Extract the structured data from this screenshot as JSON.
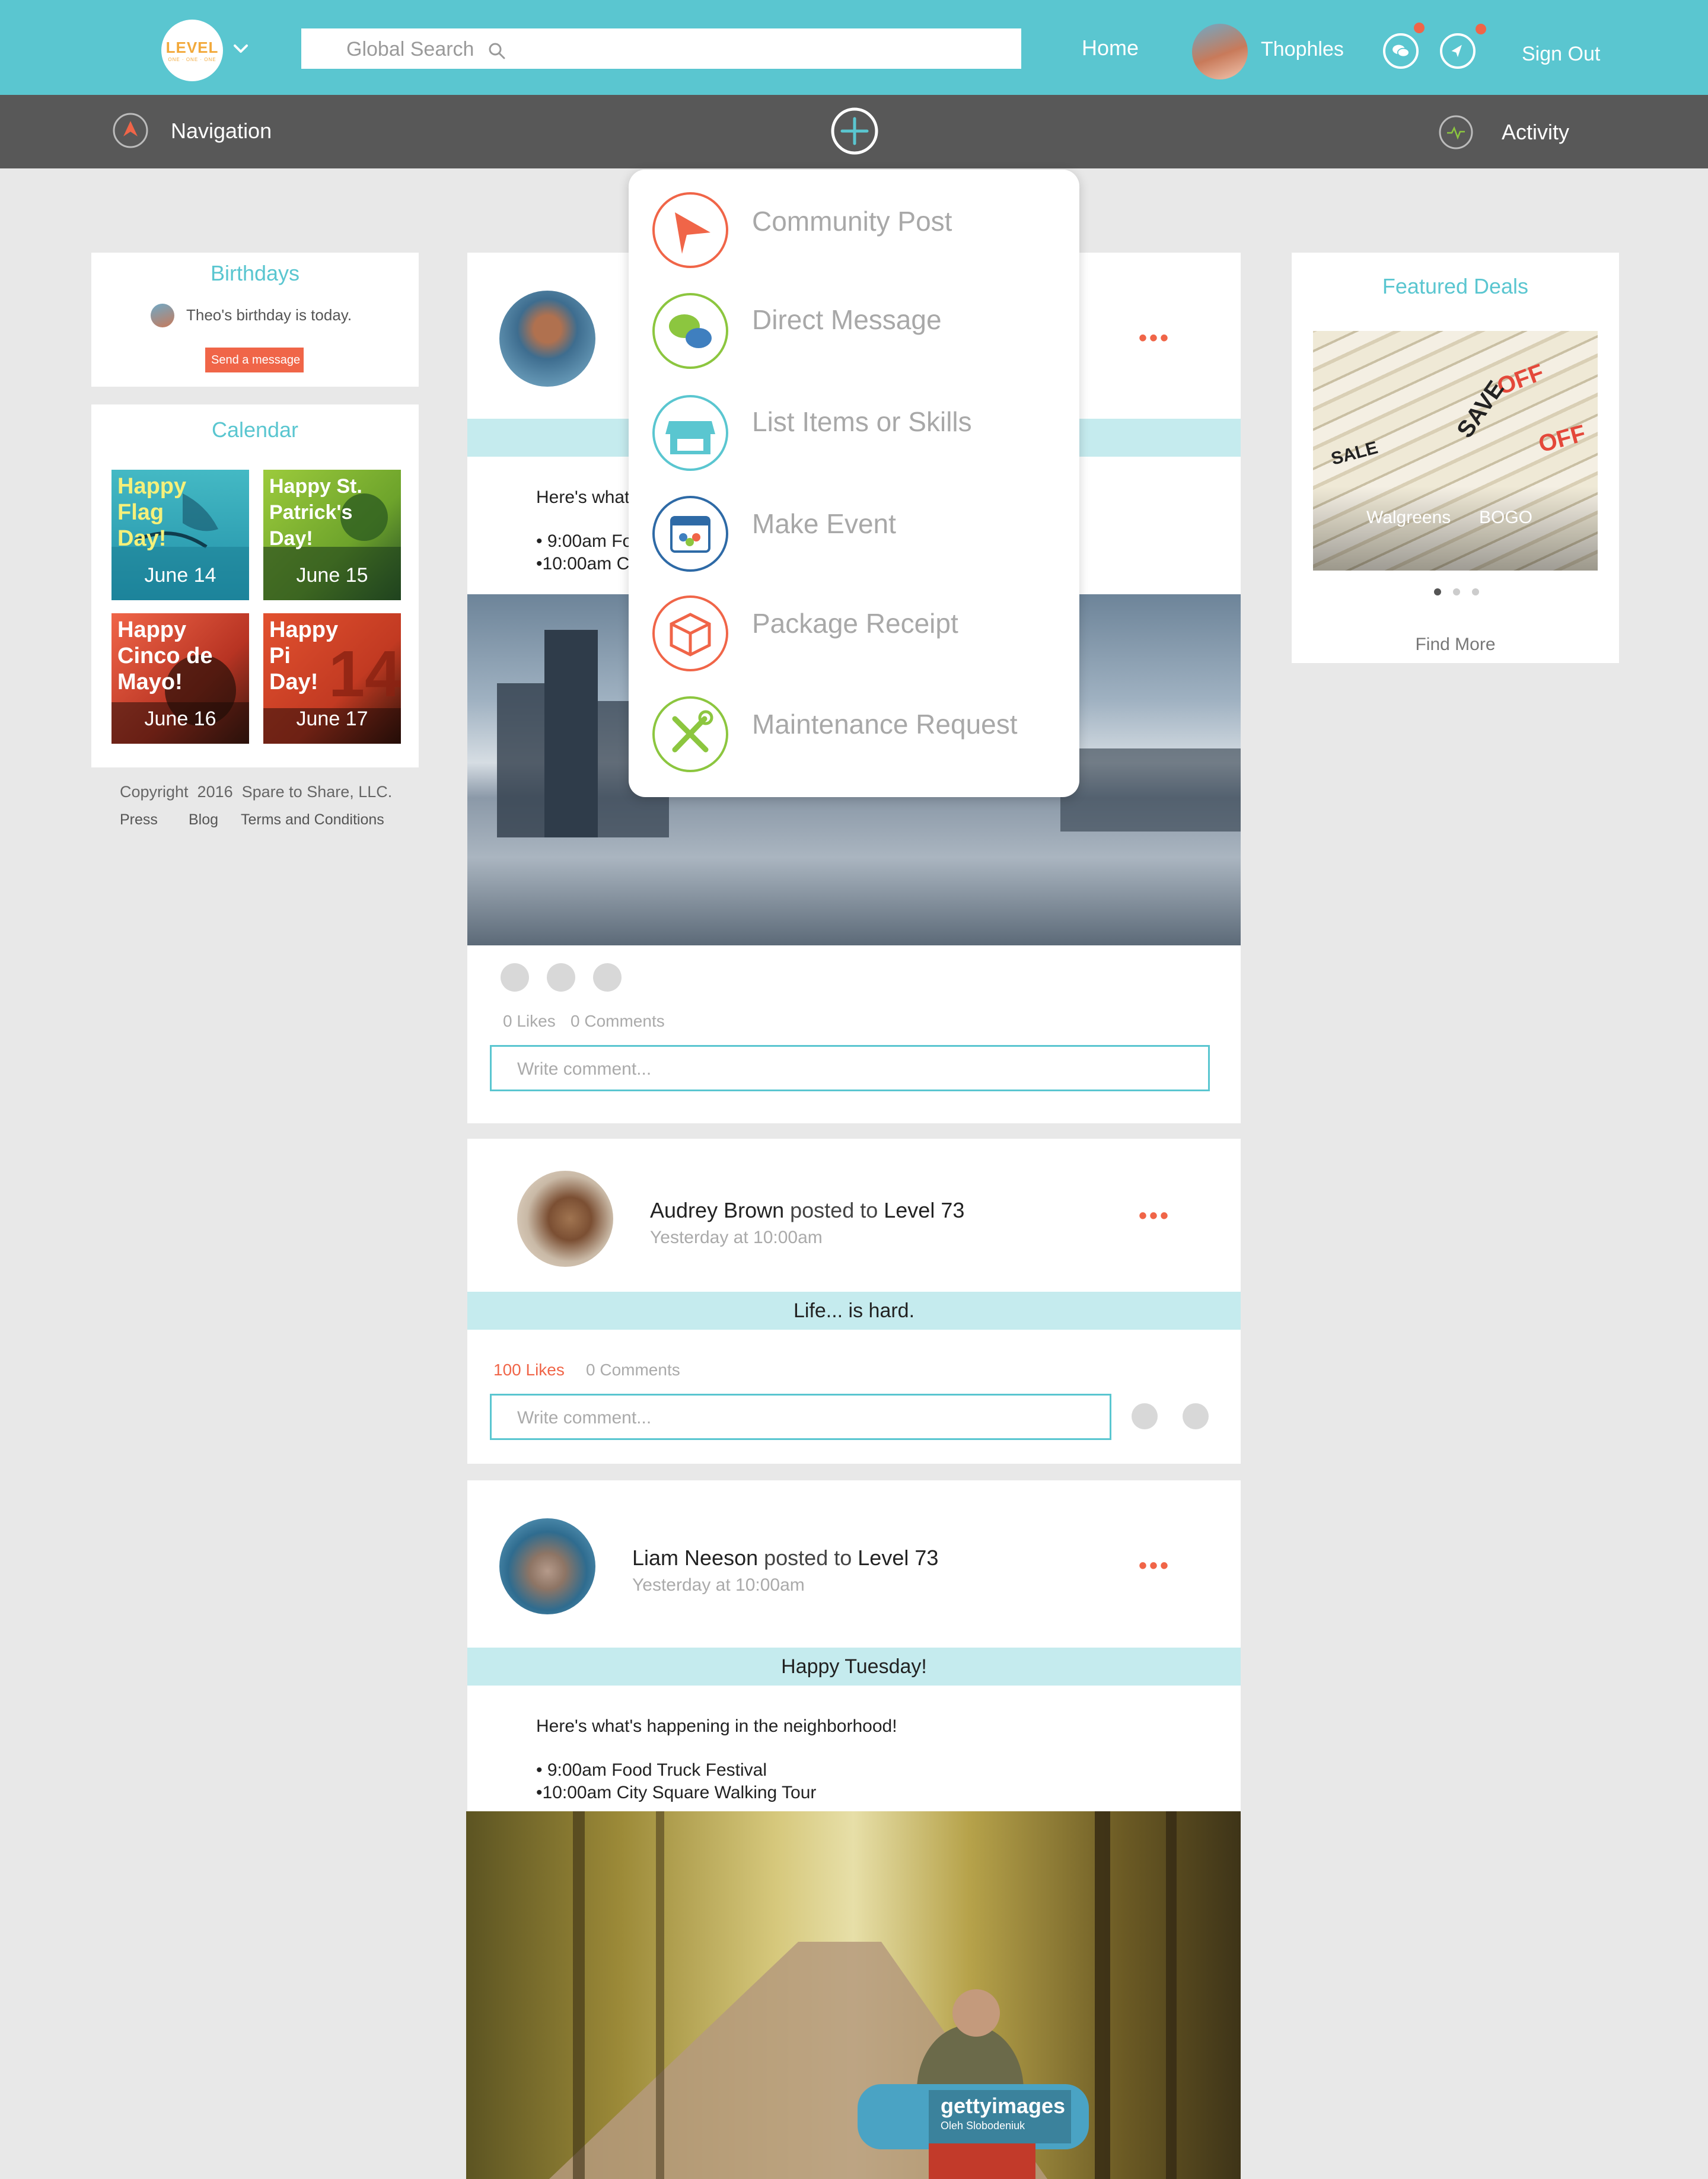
{
  "header": {
    "logo_text": "LEVEL",
    "logo_subtext": "ONE · ONE · ONE",
    "search_placeholder": "Global Search",
    "home_label": "Home",
    "username": "Thophles",
    "signout_label": "Sign Out",
    "accent_color": "#5ac6d0",
    "alert_color": "#f06548"
  },
  "subbar": {
    "navigation_label": "Navigation",
    "activity_label": "Activity"
  },
  "birthdays": {
    "title": "Birthdays",
    "text": "Theo's birthday is today.",
    "button_label": "Send a message"
  },
  "calendar": {
    "title": "Calendar",
    "tiles": [
      {
        "text": "Happy Flag Day!",
        "date": "June 14"
      },
      {
        "text": "Happy St. Patrick's Day!",
        "date": "June 15"
      },
      {
        "text": "Happy Cinco de Mayo!",
        "date": "June 16"
      },
      {
        "text": "Happy Pi Day!",
        "date": "June 17"
      }
    ]
  },
  "footer": {
    "copyright": "Copyright  2016  Spare to Share, LLC.",
    "links": [
      "Press",
      "Blog",
      "Terms and Conditions"
    ]
  },
  "menu": {
    "items": [
      {
        "label": "Community Post",
        "icon": "paper-plane-icon"
      },
      {
        "label": "Direct Message",
        "icon": "chat-bubbles-icon"
      },
      {
        "label": "List Items or Skills",
        "icon": "storefront-icon"
      },
      {
        "label": "Make Event",
        "icon": "calendar-people-icon"
      },
      {
        "label": "Package Receipt",
        "icon": "package-icon"
      },
      {
        "label": "Maintenance Request",
        "icon": "wrench-screwdriver-icon"
      }
    ]
  },
  "posts": [
    {
      "text_intro": "Here's what",
      "line1": "• 9:00am Fo",
      "line2": "•10:00am C",
      "likes": "0 Likes",
      "comments": "0 Comments",
      "comment_placeholder": "Write comment..."
    },
    {
      "author": "Audrey Brown",
      "posted_to": "posted to",
      "group": "Level 73",
      "time": "Yesterday at 10:00am",
      "banner": "Life... is hard.",
      "likes": "100 Likes",
      "comments": "0 Comments",
      "comment_placeholder": "Write comment..."
    },
    {
      "author": "Liam Neeson",
      "posted_to": "posted to",
      "group": "Level 73",
      "time": "Yesterday at 10:00am",
      "banner": "Happy Tuesday!",
      "text_intro": "Here's what's happening in the neighborhood!",
      "line1": "• 9:00am Food Truck Festival",
      "line2": "•10:00am City Square Walking Tour",
      "watermark": "gettyimages",
      "watermark_credit": "Oleh Slobodeniuk"
    }
  ],
  "deals": {
    "title": "Featured Deals",
    "caption_store": "Walgreens",
    "caption_offer": "BOGO",
    "coupon_words": [
      "OFF",
      "SAVE",
      "OFF",
      "SALE"
    ],
    "find_more": "Find More"
  }
}
